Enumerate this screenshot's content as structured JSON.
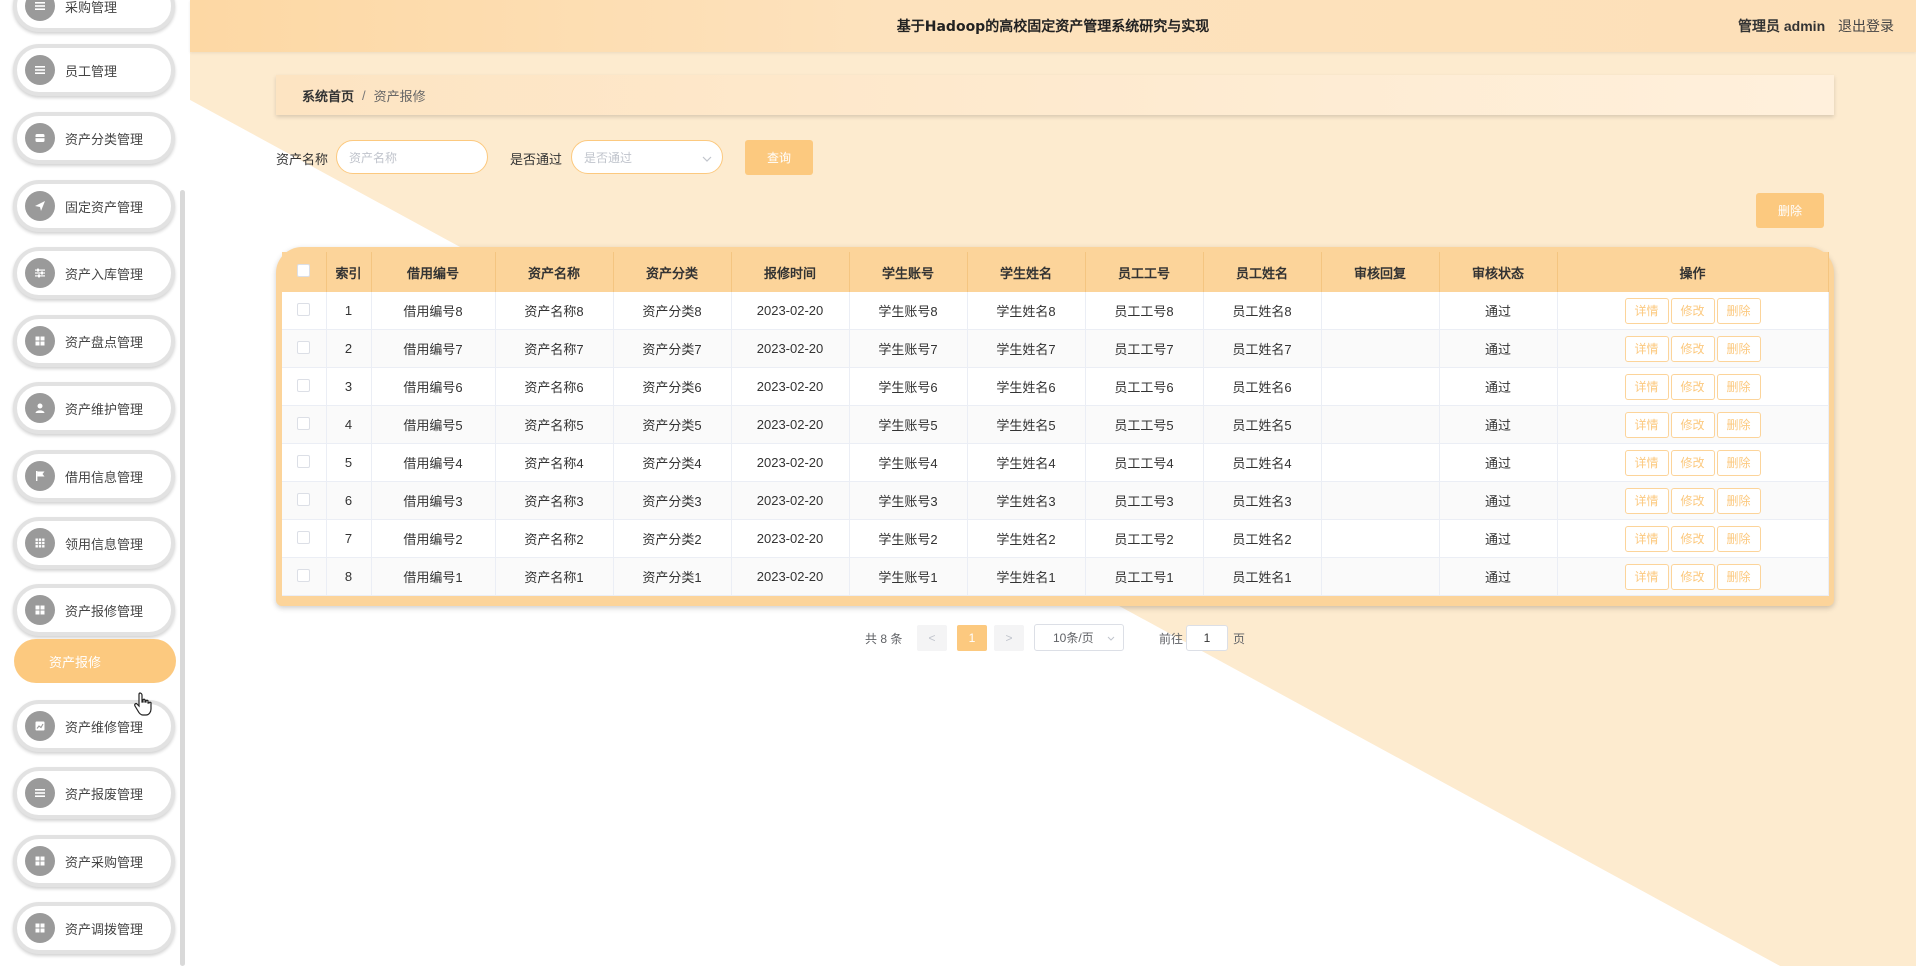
{
  "header": {
    "title": "基于Hadoop的高校固定资产管理系统研究与实现",
    "admin": "管理员 admin",
    "logout": "退出登录"
  },
  "sidebar": {
    "items": [
      {
        "label": "采购管理",
        "icon": "menu-icon"
      },
      {
        "label": "员工管理",
        "icon": "list-icon"
      },
      {
        "label": "资产分类管理",
        "icon": "box-icon"
      },
      {
        "label": "固定资产管理",
        "icon": "send-icon"
      },
      {
        "label": "资产入库管理",
        "icon": "sliders-icon"
      },
      {
        "label": "资产盘点管理",
        "icon": "grid-icon"
      },
      {
        "label": "资产维护管理",
        "icon": "user-icon"
      },
      {
        "label": "借用信息管理",
        "icon": "flag-icon"
      },
      {
        "label": "领用信息管理",
        "icon": "apps-icon"
      },
      {
        "label": "资产报修管理",
        "icon": "grid-icon"
      },
      {
        "label": "资产维修管理",
        "icon": "chart-icon"
      },
      {
        "label": "资产报废管理",
        "icon": "list-icon"
      },
      {
        "label": "资产采购管理",
        "icon": "grid-icon"
      },
      {
        "label": "资产调拨管理",
        "icon": "grid-icon"
      }
    ],
    "submenu_active": "资产报修"
  },
  "breadcrumb": {
    "home": "系统首页",
    "separator": "/",
    "current": "资产报修"
  },
  "search": {
    "name_label": "资产名称",
    "name_placeholder": "资产名称",
    "pass_label": "是否通过",
    "pass_placeholder": "是否通过",
    "query_button": "查询"
  },
  "toolbar": {
    "delete_button": "删除"
  },
  "table": {
    "columns": [
      "索引",
      "借用编号",
      "资产名称",
      "资产分类",
      "报修时间",
      "学生账号",
      "学生姓名",
      "员工工号",
      "员工姓名",
      "审核回复",
      "审核状态",
      "操作"
    ],
    "rows": [
      {
        "index": "1",
        "borrow_no": "借用编号8",
        "asset_name": "资产名称8",
        "asset_category": "资产分类8",
        "repair_time": "2023-02-20",
        "student_account": "学生账号8",
        "student_name": "学生姓名8",
        "staff_no": "员工工号8",
        "staff_name": "员工姓名8",
        "reply": "",
        "status": "通过"
      },
      {
        "index": "2",
        "borrow_no": "借用编号7",
        "asset_name": "资产名称7",
        "asset_category": "资产分类7",
        "repair_time": "2023-02-20",
        "student_account": "学生账号7",
        "student_name": "学生姓名7",
        "staff_no": "员工工号7",
        "staff_name": "员工姓名7",
        "reply": "",
        "status": "通过"
      },
      {
        "index": "3",
        "borrow_no": "借用编号6",
        "asset_name": "资产名称6",
        "asset_category": "资产分类6",
        "repair_time": "2023-02-20",
        "student_account": "学生账号6",
        "student_name": "学生姓名6",
        "staff_no": "员工工号6",
        "staff_name": "员工姓名6",
        "reply": "",
        "status": "通过"
      },
      {
        "index": "4",
        "borrow_no": "借用编号5",
        "asset_name": "资产名称5",
        "asset_category": "资产分类5",
        "repair_time": "2023-02-20",
        "student_account": "学生账号5",
        "student_name": "学生姓名5",
        "staff_no": "员工工号5",
        "staff_name": "员工姓名5",
        "reply": "",
        "status": "通过"
      },
      {
        "index": "5",
        "borrow_no": "借用编号4",
        "asset_name": "资产名称4",
        "asset_category": "资产分类4",
        "repair_time": "2023-02-20",
        "student_account": "学生账号4",
        "student_name": "学生姓名4",
        "staff_no": "员工工号4",
        "staff_name": "员工姓名4",
        "reply": "",
        "status": "通过"
      },
      {
        "index": "6",
        "borrow_no": "借用编号3",
        "asset_name": "资产名称3",
        "asset_category": "资产分类3",
        "repair_time": "2023-02-20",
        "student_account": "学生账号3",
        "student_name": "学生姓名3",
        "staff_no": "员工工号3",
        "staff_name": "员工姓名3",
        "reply": "",
        "status": "通过"
      },
      {
        "index": "7",
        "borrow_no": "借用编号2",
        "asset_name": "资产名称2",
        "asset_category": "资产分类2",
        "repair_time": "2023-02-20",
        "student_account": "学生账号2",
        "student_name": "学生姓名2",
        "staff_no": "员工工号2",
        "staff_name": "员工姓名2",
        "reply": "",
        "status": "通过"
      },
      {
        "index": "8",
        "borrow_no": "借用编号1",
        "asset_name": "资产名称1",
        "asset_category": "资产分类1",
        "repair_time": "2023-02-20",
        "student_account": "学生账号1",
        "student_name": "学生姓名1",
        "staff_no": "员工工号1",
        "staff_name": "员工姓名1",
        "reply": "",
        "status": "通过"
      }
    ],
    "row_actions": {
      "detail": "详情",
      "edit": "修改",
      "delete": "删除"
    }
  },
  "pagination": {
    "total": "共 8 条",
    "prev": "<",
    "current_page": "1",
    "next": ">",
    "page_size": "10条/页",
    "goto_prefix": "前往",
    "goto_value": "1",
    "goto_suffix": "页"
  },
  "colors": {
    "accent": "#fcc97f",
    "header_bg": "#fde0b8",
    "table_header": "#fcd49a"
  }
}
